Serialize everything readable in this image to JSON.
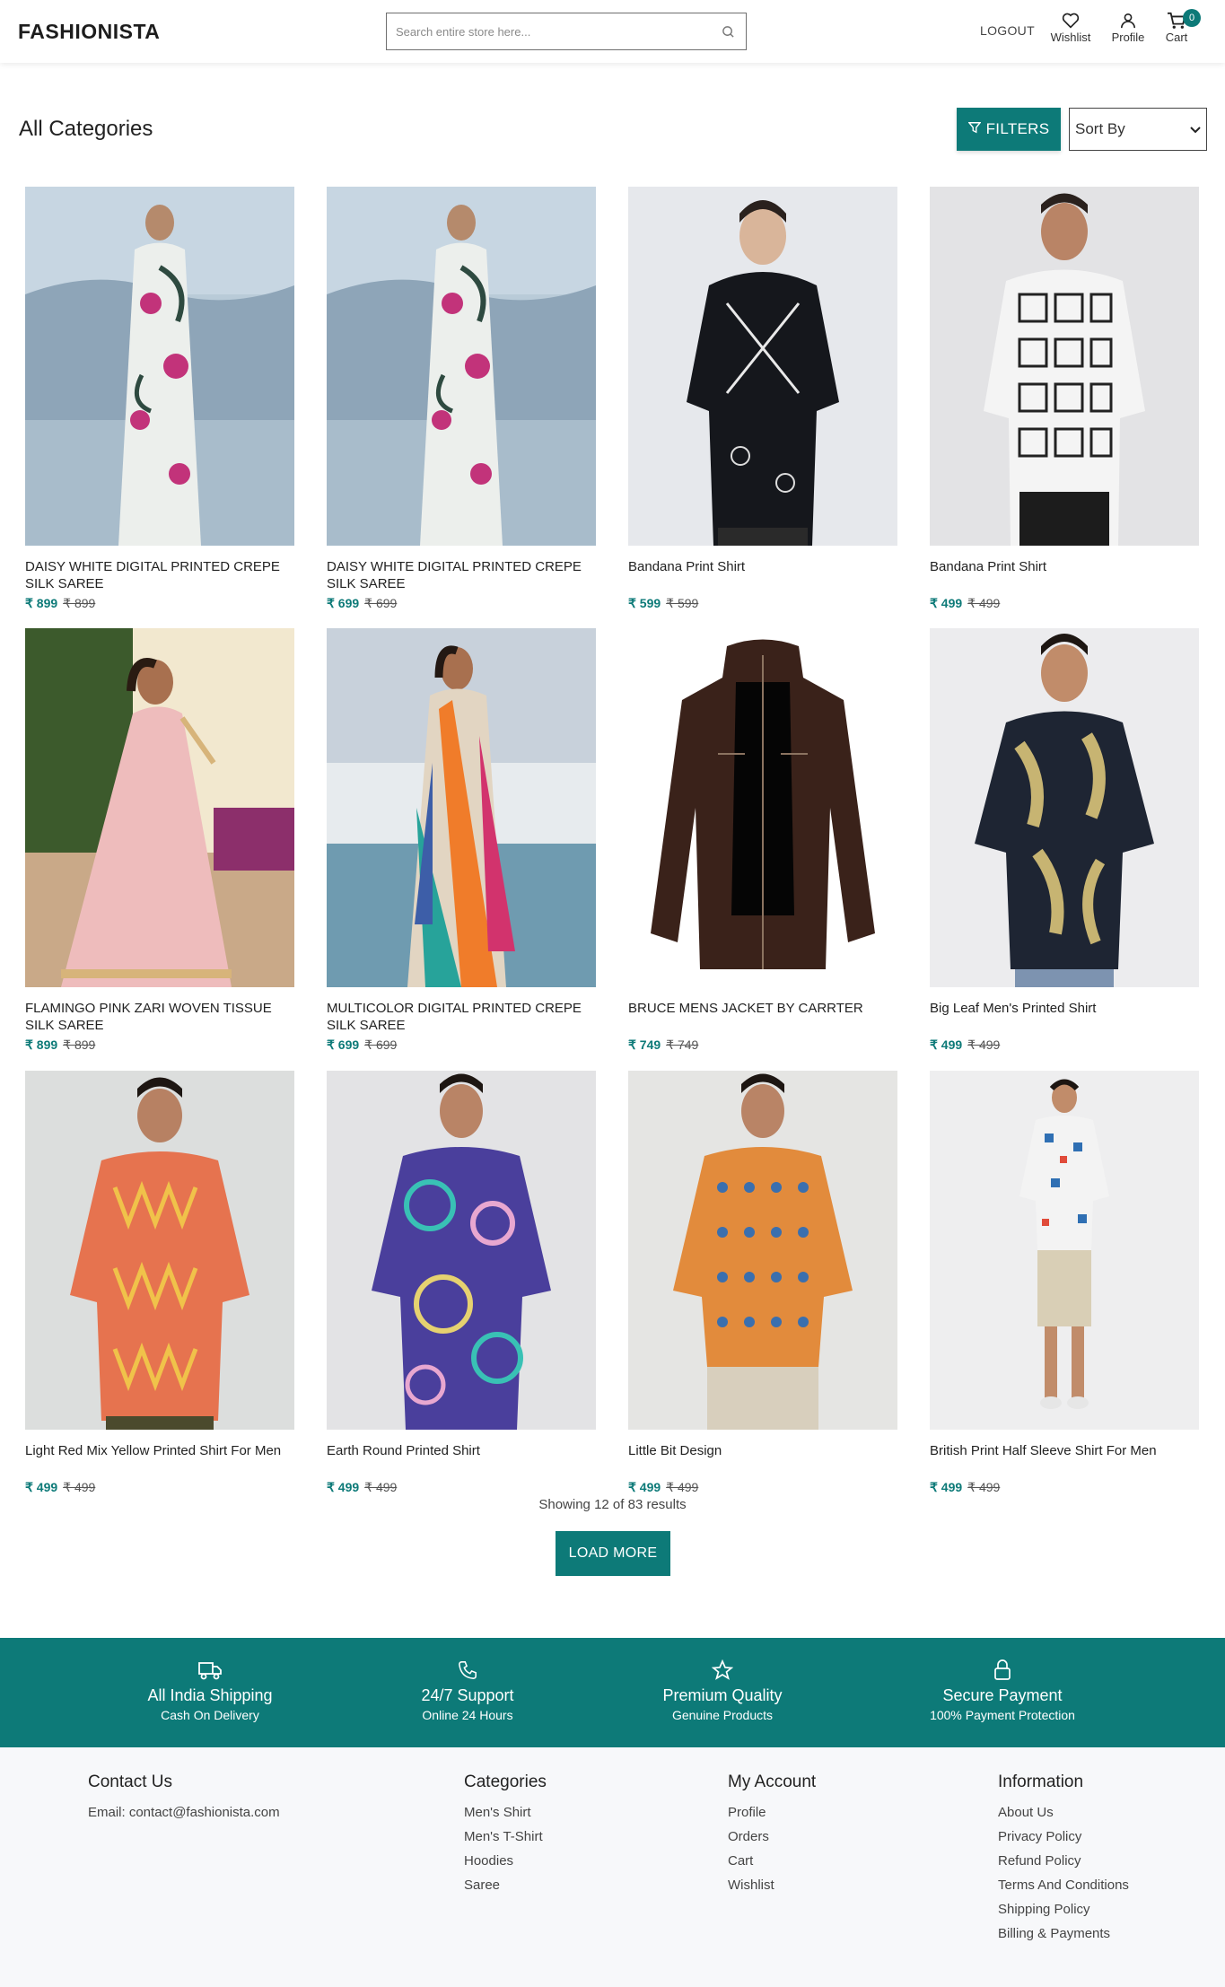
{
  "header": {
    "logo": "FASHIONISTA",
    "search_placeholder": "Search entire store here...",
    "logout": "LOGOUT",
    "wishlist": "Wishlist",
    "profile": "Profile",
    "cart": "Cart",
    "cart_count": "0"
  },
  "toolbar": {
    "title": "All Categories",
    "filters": "FILTERS",
    "sort": "Sort By"
  },
  "products": [
    {
      "name": "DAISY WHITE DIGITAL PRINTED CREPE SILK SAREE",
      "price": "₹ 899",
      "mrp": "₹ 899",
      "image": "saree-white-floral"
    },
    {
      "name": "DAISY WHITE DIGITAL PRINTED CREPE SILK SAREE",
      "price": "₹ 699",
      "mrp": "₹ 699",
      "image": "saree-white-floral"
    },
    {
      "name": "Bandana Print Shirt",
      "price": "₹ 599",
      "mrp": "₹ 599",
      "image": "shirt-bandana-black"
    },
    {
      "name": "Bandana Print Shirt",
      "price": "₹ 499",
      "mrp": "₹ 499",
      "image": "shirt-bandana-checks"
    },
    {
      "name": "FLAMINGO PINK ZARI WOVEN TISSUE SILK SAREE",
      "price": "₹ 899",
      "mrp": "₹ 899",
      "image": "saree-pink"
    },
    {
      "name": "MULTICOLOR DIGITAL PRINTED CREPE SILK SAREE",
      "price": "₹ 699",
      "mrp": "₹ 699",
      "image": "saree-multicolor"
    },
    {
      "name": "BRUCE MENS JACKET BY CARRTER",
      "price": "₹ 749",
      "mrp": "₹ 749",
      "image": "jacket-brown-leather"
    },
    {
      "name": "Big Leaf Men's Printed Shirt",
      "price": "₹ 499",
      "mrp": "₹ 499",
      "image": "shirt-big-leaf"
    },
    {
      "name": "Light Red Mix Yellow Printed Shirt For Men",
      "price": "₹ 499",
      "mrp": "₹ 499",
      "image": "shirt-red-yellow"
    },
    {
      "name": "Earth Round Printed Shirt",
      "price": "₹ 499",
      "mrp": "₹ 499",
      "image": "shirt-tie-dye"
    },
    {
      "name": "Little Bit Design",
      "price": "₹ 499",
      "mrp": "₹ 499",
      "image": "shirt-orange-print"
    },
    {
      "name": "British Print Half Sleeve Shirt For Men",
      "price": "₹ 499",
      "mrp": "₹ 499",
      "image": "shirt-british-print"
    }
  ],
  "results_text": "Showing 12 of 83 results",
  "load_more": "LOAD MORE",
  "features": [
    {
      "icon": "truck-icon",
      "title": "All India Shipping",
      "subtitle": "Cash On Delivery"
    },
    {
      "icon": "phone-icon",
      "title": "24/7 Support",
      "subtitle": "Online 24 Hours"
    },
    {
      "icon": "star-icon",
      "title": "Premium Quality",
      "subtitle": "Genuine Products"
    },
    {
      "icon": "lock-icon",
      "title": "Secure Payment",
      "subtitle": "100% Payment Protection"
    }
  ],
  "footer": {
    "contact": {
      "heading": "Contact Us",
      "email": "Email: contact@fashionista.com"
    },
    "categories": {
      "heading": "Categories",
      "links": [
        "Men's Shirt",
        "Men's T-Shirt",
        "Hoodies",
        "Saree"
      ]
    },
    "account": {
      "heading": "My Account",
      "links": [
        "Profile",
        "Orders",
        "Cart",
        "Wishlist"
      ]
    },
    "information": {
      "heading": "Information",
      "links": [
        "About Us",
        "Privacy Policy",
        "Refund Policy",
        "Terms And Conditions",
        "Shipping Policy",
        "Billing & Payments"
      ]
    }
  },
  "colors": {
    "accent": "#0d7a78"
  }
}
